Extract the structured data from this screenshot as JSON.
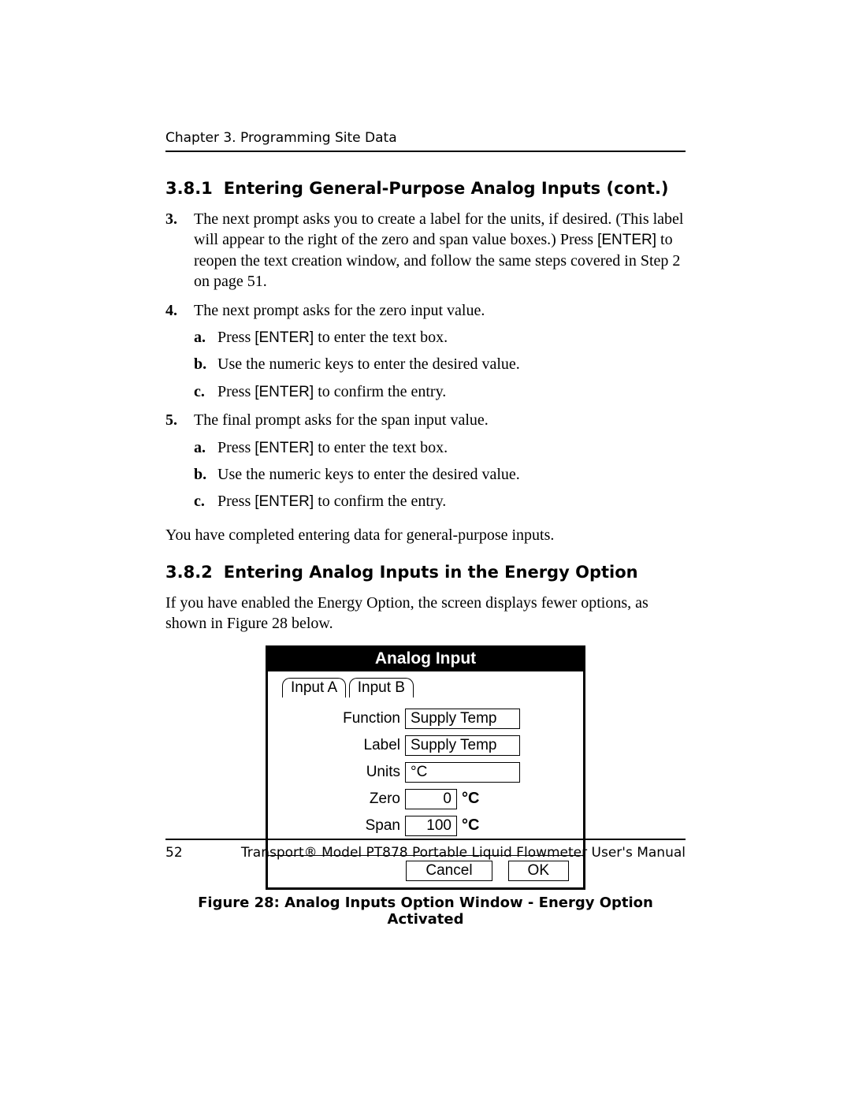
{
  "running_header": "Chapter 3. Programming Site Data",
  "section_381": {
    "number": "3.8.1",
    "title": "Entering General-Purpose Analog Inputs (cont.)"
  },
  "step3": {
    "num": "3.",
    "text_a": "The next prompt asks you to create a label for the units, if desired. (This label will appear to the right of the zero and span value boxes.) Press ",
    "enter": "[ENTER]",
    "text_b": " to reopen the text creation window, and follow the same steps covered in Step 2 on page 51."
  },
  "step4": {
    "num": "4.",
    "text": "The next prompt asks for the zero input value.",
    "a_num": "a.",
    "a_pre": "Press ",
    "a_enter": "[ENTER]",
    "a_post": " to enter the text box.",
    "b_num": "b.",
    "b_text": "Use the numeric keys to enter the desired value.",
    "c_num": "c.",
    "c_pre": "Press ",
    "c_enter": "[ENTER]",
    "c_post": " to confirm the entry."
  },
  "step5": {
    "num": "5.",
    "text": "The final prompt asks for the span input value.",
    "a_num": "a.",
    "a_pre": "Press ",
    "a_enter": "[ENTER]",
    "a_post": " to enter the text box.",
    "b_num": "b.",
    "b_text": "Use the numeric keys to enter the desired value.",
    "c_num": "c.",
    "c_pre": "Press ",
    "c_enter": "[ENTER]",
    "c_post": " to confirm the entry."
  },
  "closing_381": "You have completed entering data for general-purpose inputs.",
  "section_382": {
    "number": "3.8.2",
    "title": "Entering Analog Inputs in the Energy Option"
  },
  "intro_382": "If you have enabled the Energy Option, the screen displays fewer options, as shown in Figure 28 below.",
  "device": {
    "title": "Analog Input",
    "tabs": {
      "a": "Input A",
      "b": "Input B"
    },
    "rows": {
      "function": {
        "label": "Function",
        "value": "Supply Temp"
      },
      "label": {
        "label": "Label",
        "value": "Supply Temp"
      },
      "units": {
        "label": "Units",
        "value": "°C"
      },
      "zero": {
        "label": "Zero",
        "value": "0",
        "suffix": "°C"
      },
      "span": {
        "label": "Span",
        "value": "100",
        "suffix": "°C"
      }
    },
    "buttons": {
      "cancel": "Cancel",
      "ok": "OK"
    }
  },
  "figure_caption": "Figure 28: Analog Inputs Option Window - Energy Option Activated",
  "footer": {
    "page_number": "52",
    "text": "Transport® Model PT878 Portable Liquid Flowmeter User's Manual"
  }
}
